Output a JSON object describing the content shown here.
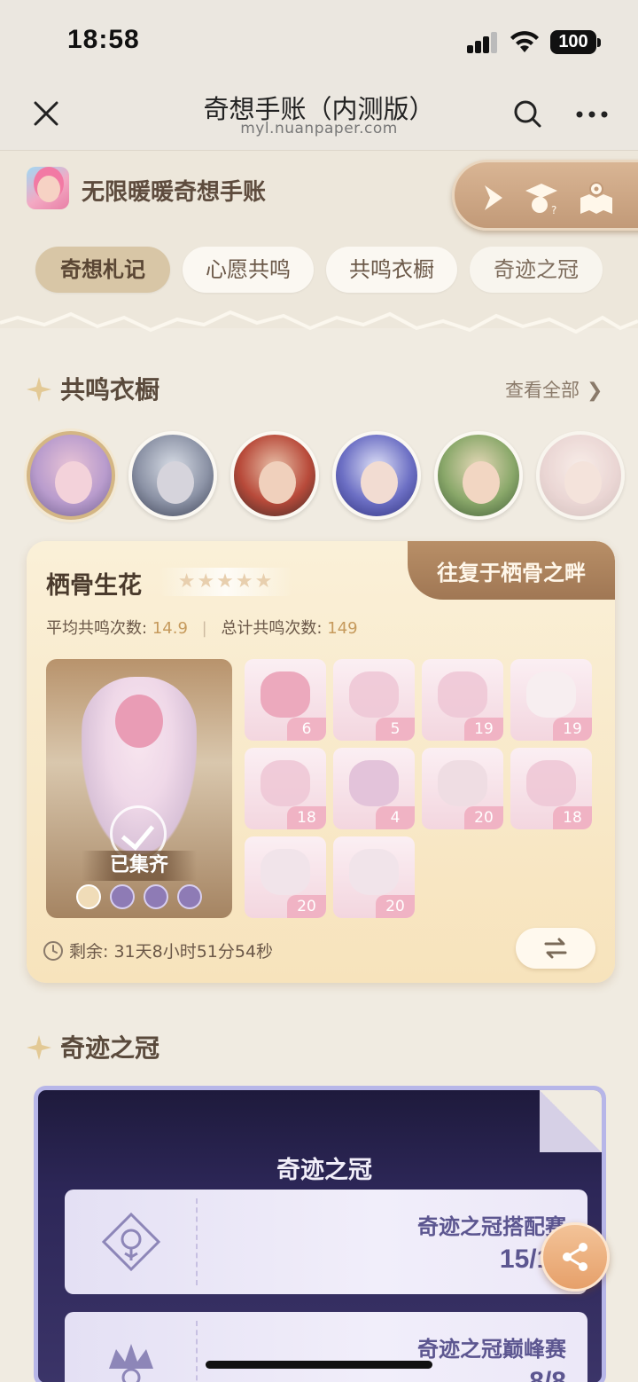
{
  "status_bar": {
    "time": "18:58",
    "battery": "100"
  },
  "nav": {
    "title": "奇想手账（内测版）",
    "subtitle": "myl.nuanpaper.com"
  },
  "app": {
    "name": "无限暖暖奇想手账"
  },
  "tabs": [
    {
      "label": "奇想札记",
      "active": true
    },
    {
      "label": "心愿共鸣",
      "active": false
    },
    {
      "label": "共鸣衣橱",
      "active": false
    },
    {
      "label": "奇迹之冠",
      "active": false
    }
  ],
  "wardrobe": {
    "title": "共鸣衣橱",
    "see_all": "查看全部",
    "avatar_count": 6,
    "card": {
      "name": "栖骨生花",
      "stars": "★★★★★",
      "ribbon": "往复于栖骨之畔",
      "avg_label": "平均共鸣次数:",
      "avg_value": "14.9",
      "total_label": "总计共鸣次数:",
      "total_value": "149",
      "collected_badge": "已集齐",
      "pieces": [
        "6",
        "5",
        "19",
        "19",
        "18",
        "4",
        "20",
        "18",
        "20",
        "20"
      ],
      "remaining": "剩余: 31天8小时51分54秒"
    }
  },
  "crown": {
    "section_title": "奇迹之冠",
    "card_title": "奇迹之冠",
    "rows": [
      {
        "label": "奇迹之冠搭配赛",
        "value": "15/15"
      },
      {
        "label": "奇迹之冠巅峰赛",
        "value": "8/8"
      }
    ]
  },
  "colors": {
    "accent": "#d8c6a6",
    "ribbon": "#a07754",
    "crown_bg": "#2d2758",
    "share": "#e6a06a"
  }
}
